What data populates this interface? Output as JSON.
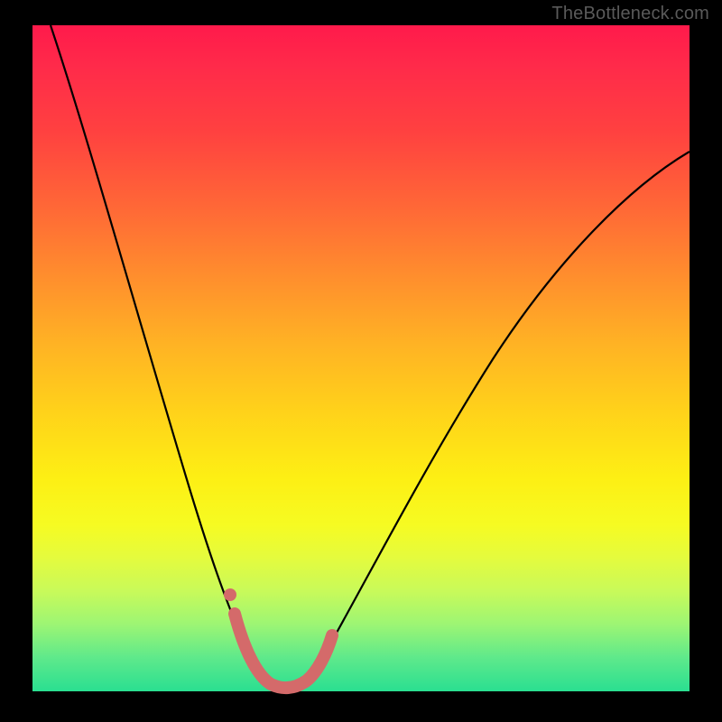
{
  "watermark": {
    "text": "TheBottleneck.com"
  },
  "chart_data": {
    "type": "line",
    "title": "",
    "xlabel": "",
    "ylabel": "",
    "xlim": [
      0,
      100
    ],
    "ylim": [
      0,
      100
    ],
    "series": [
      {
        "name": "bottleneck-curve",
        "x": [
          3,
          5,
          8,
          11,
          14,
          17,
          20,
          23,
          26,
          28,
          30,
          32,
          34,
          36,
          38,
          40,
          43,
          47,
          52,
          58,
          64,
          70,
          76,
          82,
          88,
          94,
          99
        ],
        "values": [
          100,
          91,
          80,
          70,
          61,
          53,
          45,
          37,
          29,
          23,
          17,
          12,
          8,
          4,
          2,
          1,
          1.5,
          4,
          9,
          17,
          26,
          36,
          46,
          55,
          63,
          70,
          75
        ]
      },
      {
        "name": "highlight-band",
        "x": [
          30.5,
          31,
          33,
          35,
          37,
          39,
          41,
          43,
          44.5
        ],
        "values": [
          12,
          8,
          3.5,
          1.5,
          1,
          1,
          1.5,
          3.5,
          8
        ]
      },
      {
        "name": "highlight-dot",
        "x": [
          30
        ],
        "values": [
          15
        ]
      }
    ],
    "colors": {
      "curve": "#000000",
      "highlight": "#d46a6a",
      "gradient_top": "#ff1a4b",
      "gradient_mid": "#ffd21a",
      "gradient_bottom": "#2adf91"
    }
  }
}
